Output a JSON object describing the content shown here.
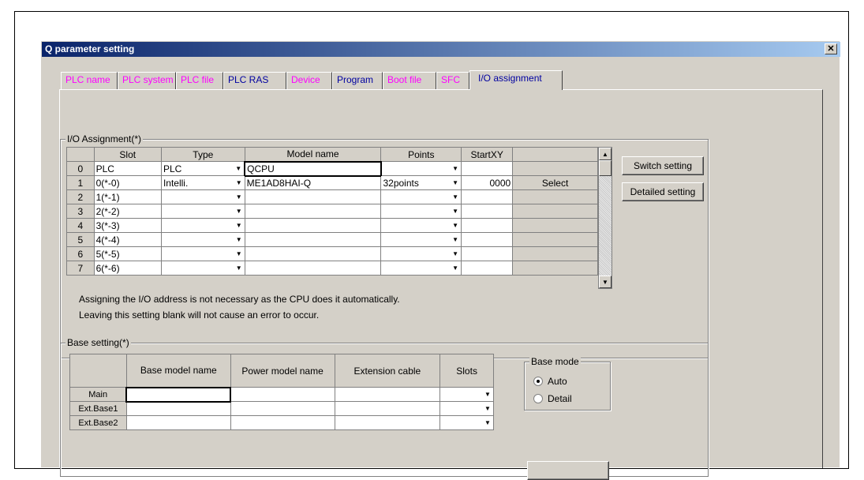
{
  "window": {
    "title": "Q parameter setting",
    "close_glyph": "✕"
  },
  "tabs": [
    {
      "label": "PLC name",
      "color": "#ff00ff"
    },
    {
      "label": "PLC system",
      "color": "#ff00ff"
    },
    {
      "label": "PLC file",
      "color": "#ff00ff"
    },
    {
      "label": "PLC RAS",
      "color": "#0000a0"
    },
    {
      "label": "Device",
      "color": "#ff00ff"
    },
    {
      "label": "Program",
      "color": "#0000a0"
    },
    {
      "label": "Boot file",
      "color": "#ff00ff"
    },
    {
      "label": "SFC",
      "color": "#ff00ff"
    },
    {
      "label": "I/O assignment",
      "color": "#0000a0",
      "selected": true
    }
  ],
  "io_assignment": {
    "group_label": "I/O Assignment(*)",
    "headers": {
      "slot": "Slot",
      "type": "Type",
      "model": "Model name",
      "points": "Points",
      "startxy": "StartXY"
    },
    "rows": [
      {
        "num": "0",
        "slot": "PLC",
        "type": "PLC",
        "model": "QCPU",
        "points": "",
        "startxy": "",
        "btn": ""
      },
      {
        "num": "1",
        "slot": "0(*-0)",
        "type": "Intelli.",
        "model": "ME1AD8HAI-Q",
        "points": "32points",
        "startxy": "0000",
        "btn": "Select"
      },
      {
        "num": "2",
        "slot": "1(*-1)",
        "type": "",
        "model": "",
        "points": "",
        "startxy": "",
        "btn": ""
      },
      {
        "num": "3",
        "slot": "2(*-2)",
        "type": "",
        "model": "",
        "points": "",
        "startxy": "",
        "btn": ""
      },
      {
        "num": "4",
        "slot": "3(*-3)",
        "type": "",
        "model": "",
        "points": "",
        "startxy": "",
        "btn": ""
      },
      {
        "num": "5",
        "slot": "4(*-4)",
        "type": "",
        "model": "",
        "points": "",
        "startxy": "",
        "btn": ""
      },
      {
        "num": "6",
        "slot": "5(*-5)",
        "type": "",
        "model": "",
        "points": "",
        "startxy": "",
        "btn": ""
      },
      {
        "num": "7",
        "slot": "6(*-6)",
        "type": "",
        "model": "",
        "points": "",
        "startxy": "",
        "btn": ""
      }
    ],
    "note1": "Assigning the I/O address is not necessary as the CPU does it automatically.",
    "note2": "Leaving this setting blank will not cause an error to occur.",
    "switch_button": "Switch setting",
    "detailed_button": "Detailed setting"
  },
  "base_setting": {
    "group_label": "Base setting(*)",
    "headers": {
      "base_model": "Base model name",
      "power_model": "Power model name",
      "ext_cable": "Extension cable",
      "slots": "Slots"
    },
    "rows": [
      {
        "label": "Main"
      },
      {
        "label": "Ext.Base1"
      },
      {
        "label": "Ext.Base2"
      }
    ],
    "base_mode": {
      "label": "Base mode",
      "options": [
        {
          "label": "Auto",
          "selected": true
        },
        {
          "label": "Detail",
          "selected": false
        }
      ]
    }
  }
}
